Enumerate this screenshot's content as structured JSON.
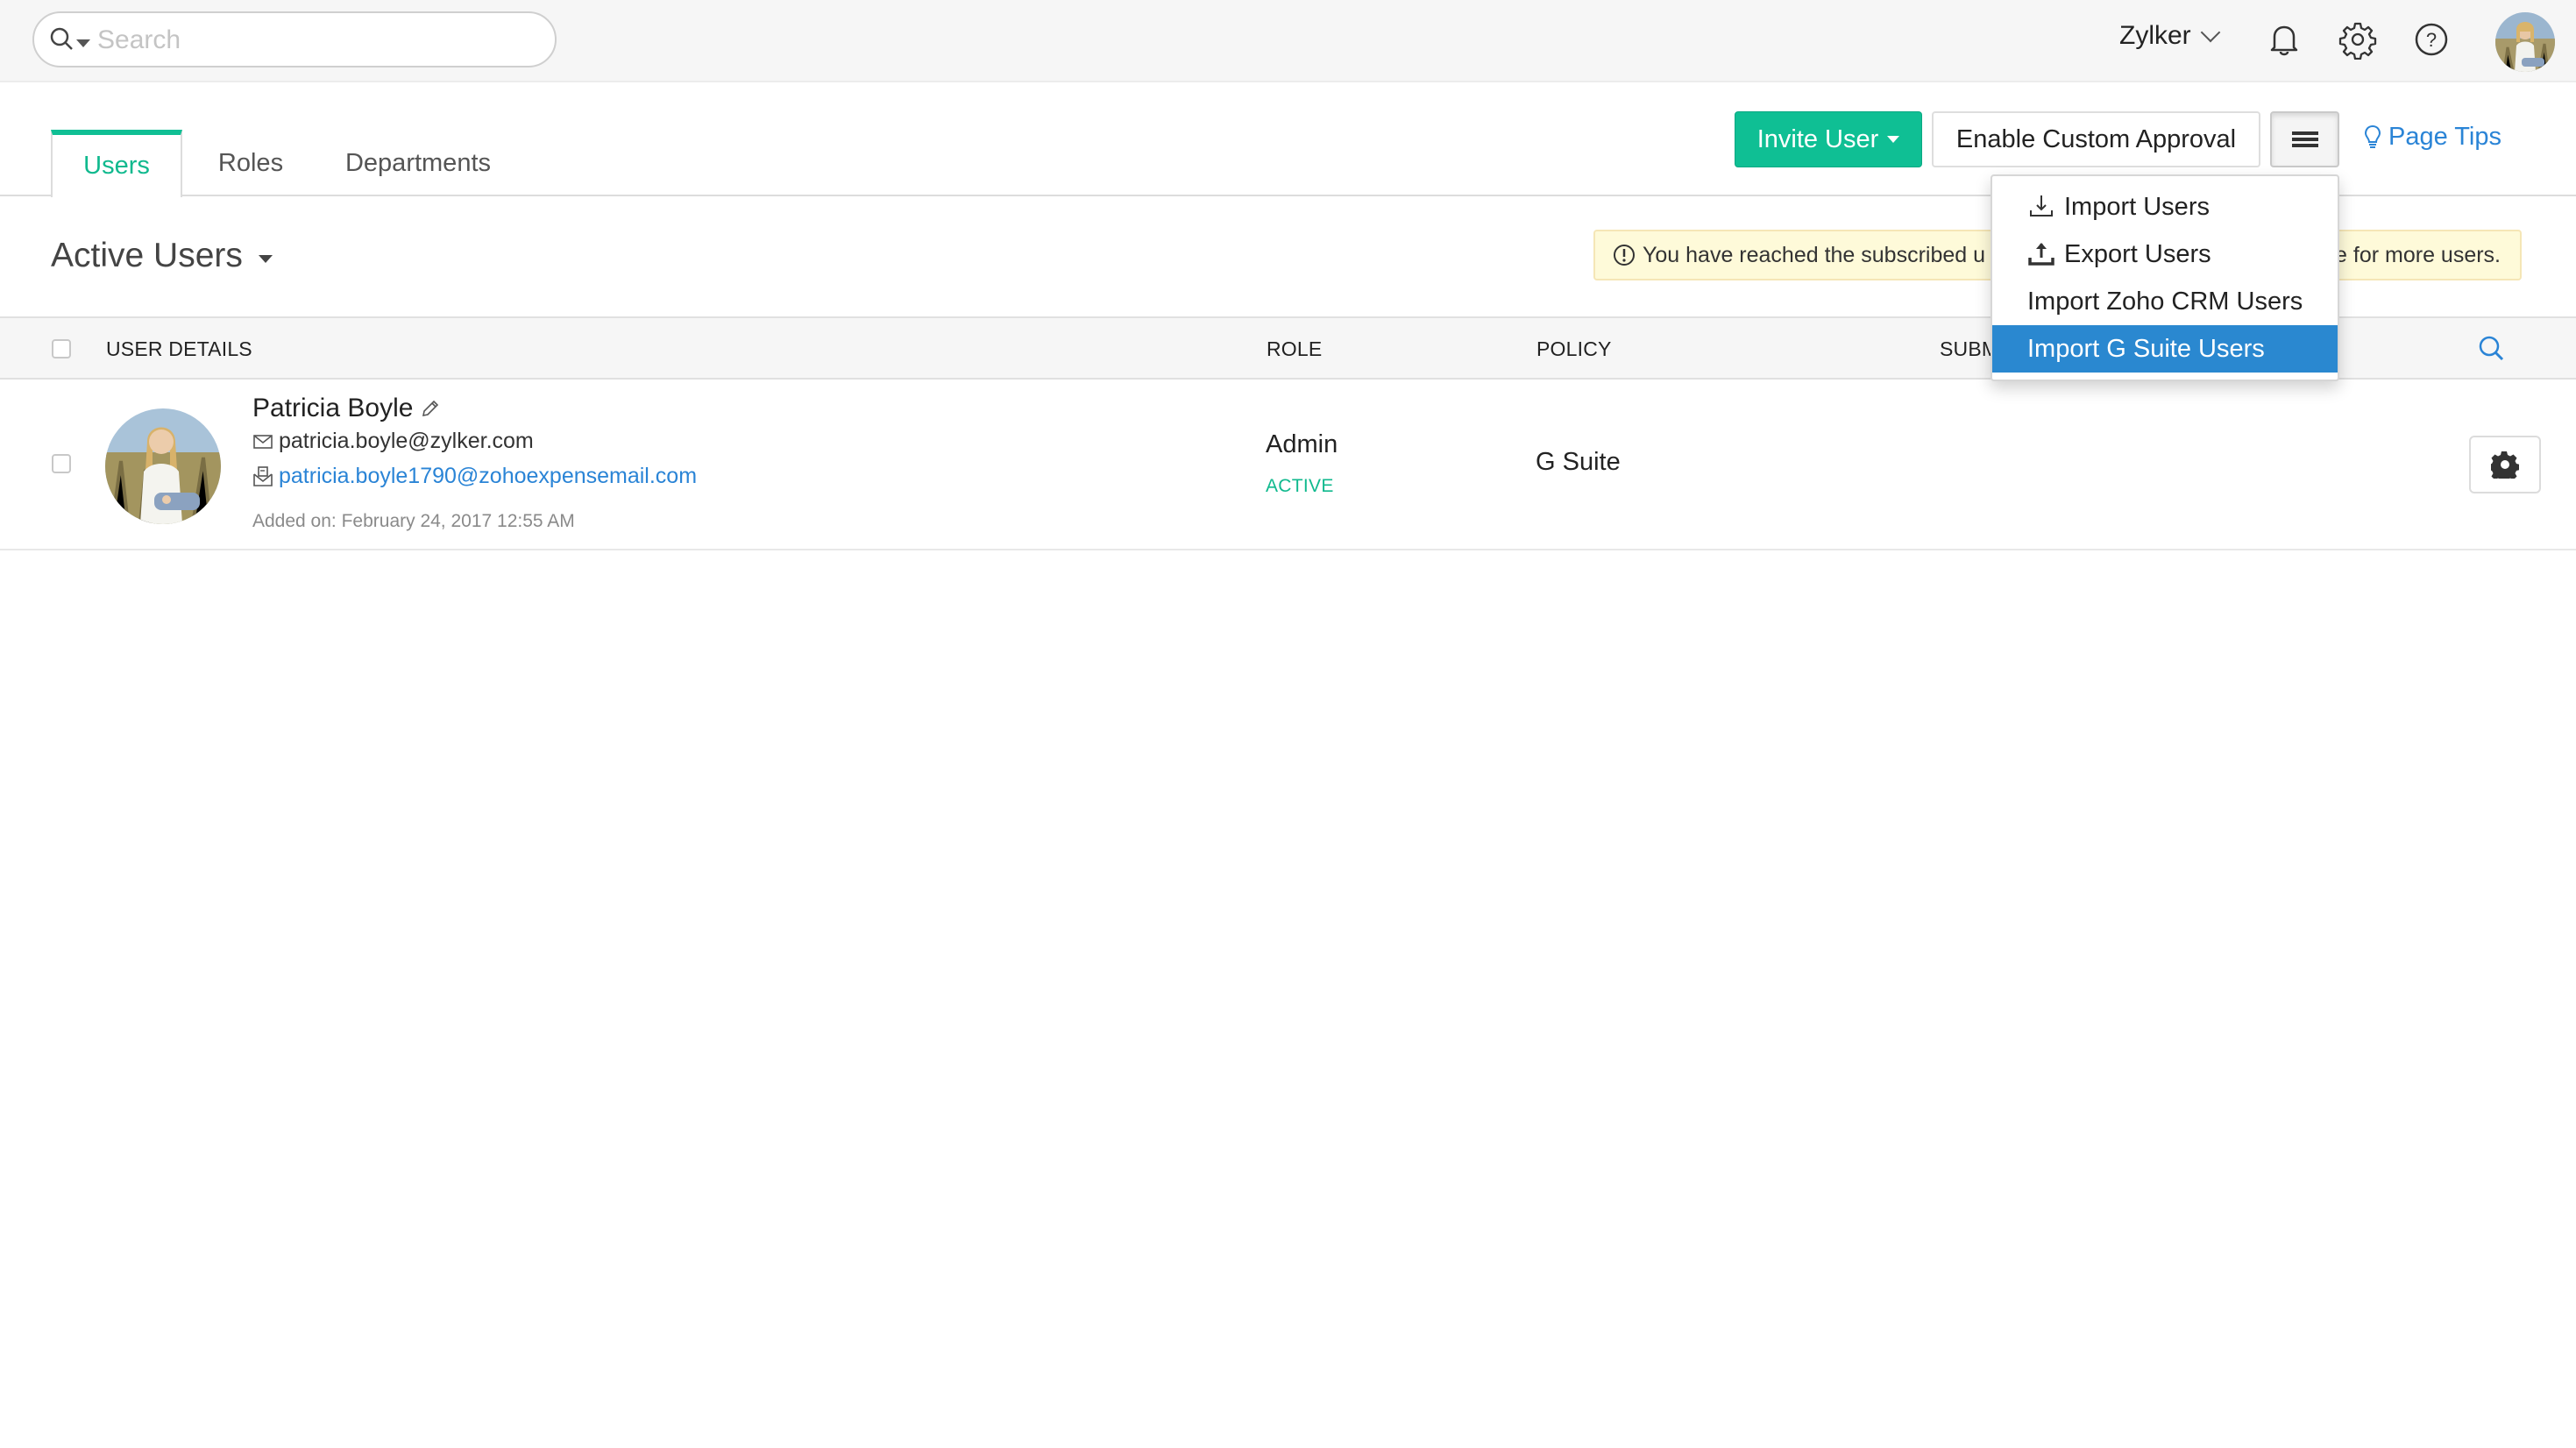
{
  "topbar": {
    "search_placeholder": "Search",
    "search_value": "",
    "org_name": "Zylker",
    "icons": [
      "search-icon",
      "bell-icon",
      "gear-icon",
      "help-icon"
    ]
  },
  "tabs": [
    {
      "label": "Users",
      "active": true
    },
    {
      "label": "Roles",
      "active": false
    },
    {
      "label": "Departments",
      "active": false
    }
  ],
  "toolbar": {
    "invite_label": "Invite User",
    "approval_label": "Enable Custom Approval",
    "page_tips_label": "Page Tips"
  },
  "menu": {
    "items": [
      {
        "label": "Import Users",
        "icon": "download-icon",
        "highlighted": false
      },
      {
        "label": "Export Users",
        "icon": "upload-icon",
        "highlighted": false
      },
      {
        "label": "Import Zoho CRM Users",
        "icon": "",
        "highlighted": false
      },
      {
        "label": "Import G Suite Users",
        "icon": "",
        "highlighted": true
      }
    ]
  },
  "filter": {
    "label": "Active Users"
  },
  "banner": {
    "text_start": "You have reached the subscribed u",
    "text_end": "e for more users."
  },
  "table": {
    "headers": {
      "user_details": "USER DETAILS",
      "role": "ROLE",
      "policy": "POLICY",
      "submits": "SUBM"
    },
    "rows": [
      {
        "name": "Patricia Boyle",
        "email": "patricia.boyle@zylker.com",
        "forward_email": "patricia.boyle1790@zohoexpensemail.com",
        "added_on": "Added on: February 24, 2017 12:55 AM",
        "role": "Admin",
        "status": "ACTIVE",
        "policy": "G Suite"
      }
    ]
  },
  "colors": {
    "accent_green": "#0fbf94",
    "link_blue": "#2a84d6",
    "menu_highlight": "#2a88d0",
    "banner_bg": "#fefad9"
  }
}
